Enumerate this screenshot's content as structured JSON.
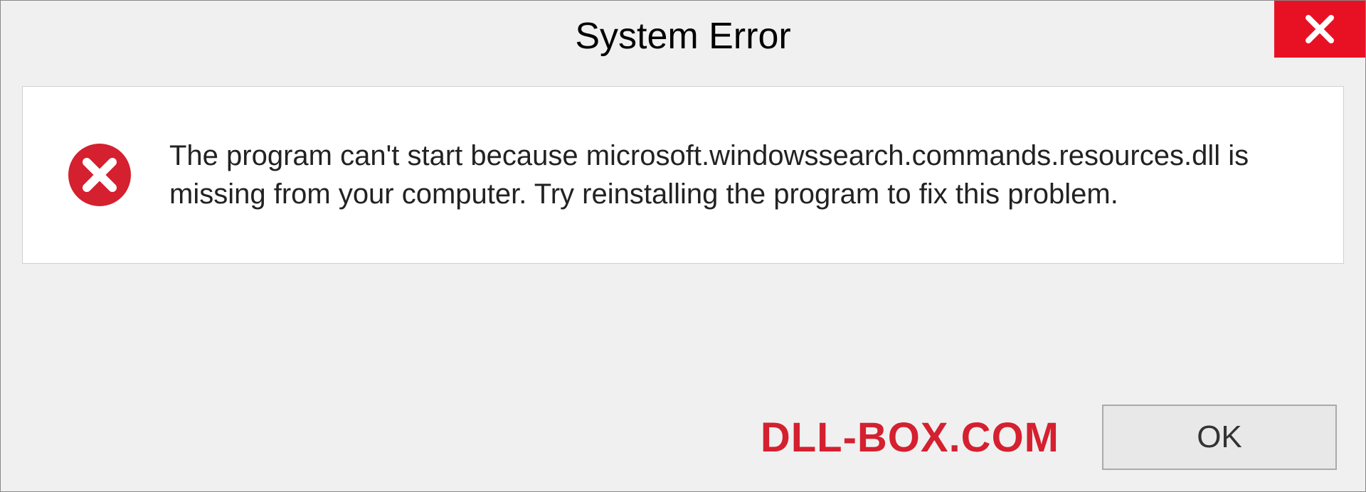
{
  "titlebar": {
    "title": "System Error"
  },
  "error": {
    "message": "The program can't start because microsoft.windowssearch.commands.resources.dll is missing from your computer. Try reinstalling the program to fix this problem."
  },
  "footer": {
    "watermark": "DLL-BOX.COM",
    "ok_label": "OK"
  },
  "colors": {
    "close_bg": "#e81123",
    "watermark": "#d4202f",
    "panel_bg": "#ffffff",
    "window_bg": "#f0f0f0"
  }
}
